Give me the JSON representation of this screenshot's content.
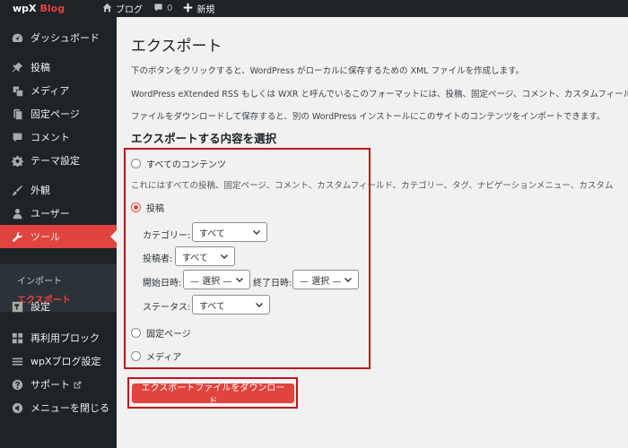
{
  "adminbar": {
    "logo_main": "wpX",
    "logo_accent": "Blog",
    "site_name": "ブログ",
    "comments_count": "0",
    "new_label": "新規"
  },
  "sidebar": {
    "items": [
      {
        "label": "ダッシュボード",
        "icon": "dashboard-icon"
      },
      {
        "label": "投稿",
        "icon": "pin-icon"
      },
      {
        "label": "メディア",
        "icon": "media-icon"
      },
      {
        "label": "固定ページ",
        "icon": "page-icon"
      },
      {
        "label": "コメント",
        "icon": "comment-icon"
      },
      {
        "label": "テーマ設定",
        "icon": "gear-icon"
      },
      {
        "label": "外観",
        "icon": "brush-icon"
      },
      {
        "label": "ユーザー",
        "icon": "user-icon"
      },
      {
        "label": "ツール",
        "icon": "wrench-icon"
      },
      {
        "label": "設定",
        "icon": "settings-icon"
      },
      {
        "label": "再利用ブロック",
        "icon": "blocks-icon"
      },
      {
        "label": "wpXブログ設定",
        "icon": "menu-lines-icon"
      },
      {
        "label": "サポート",
        "icon": "help-icon"
      },
      {
        "label": "メニューを閉じる",
        "icon": "collapse-icon"
      }
    ],
    "submenu": [
      {
        "label": "インポート"
      },
      {
        "label": "エクスポート"
      }
    ]
  },
  "page": {
    "title": "エクスポート",
    "para1": "下のボタンをクリックすると、WordPress がローカルに保存するための XML ファイルを作成します。",
    "para2": "WordPress eXtended RSS もしくは WXR と呼んでいるこのフォーマットには、投稿、固定ページ、コメント、カスタムフィール",
    "para3": "ファイルをダウンロードして保存すると、別の WordPress インストールにこのサイトのコンテンツをインポートできます。",
    "section_title": "エクスポートする内容を選択"
  },
  "export_options": {
    "all_label": "すべてのコンテンツ",
    "all_desc": "これにはすべての投稿、固定ページ、コメント、カスタムフィールド、カテゴリー、タグ、ナビゲーションメニュー、カスタム",
    "posts_label": "投稿",
    "category_label": "カテゴリー:",
    "category_value": "すべて",
    "author_label": "投稿者:",
    "author_value": "すべて",
    "start_date_label": "開始日時:",
    "start_date_value": "— 選択 —",
    "end_date_label": "終了日時:",
    "end_date_value": "— 選択 —",
    "status_label": "ステータス:",
    "status_value": "すべて",
    "pages_label": "固定ページ",
    "media_label": "メディア",
    "selected": "posts"
  },
  "download_button": "エクスポートファイルをダウンロード",
  "colors": {
    "accent": "#e0443e",
    "highlight_box": "#c0161b",
    "sidebar_bg": "#1d2327"
  }
}
